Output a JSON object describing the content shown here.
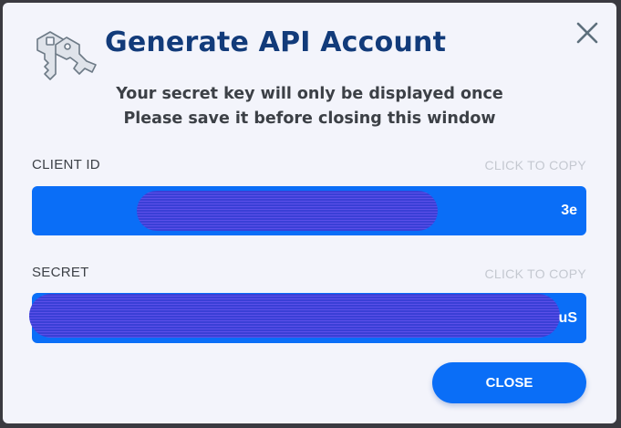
{
  "dialog": {
    "title": "Generate API Account",
    "subtitle_line1": "Your secret key will only be displayed once",
    "subtitle_line2": "Please save it before closing this window",
    "close_icon": "close-x-icon",
    "logo_icon": "keys-icon"
  },
  "client_id": {
    "label": "CLIENT ID",
    "copy_label": "CLICK TO COPY",
    "value_visible_suffix": "3e"
  },
  "secret": {
    "label": "SECRET",
    "copy_label": "CLICK TO COPY",
    "value_visible_suffix": "uS"
  },
  "actions": {
    "close_label": "CLOSE"
  },
  "colors": {
    "accent": "#0a6ef7",
    "title": "#123b7a",
    "muted": "#c4c8d0",
    "redaction": "#3a3fd6"
  }
}
